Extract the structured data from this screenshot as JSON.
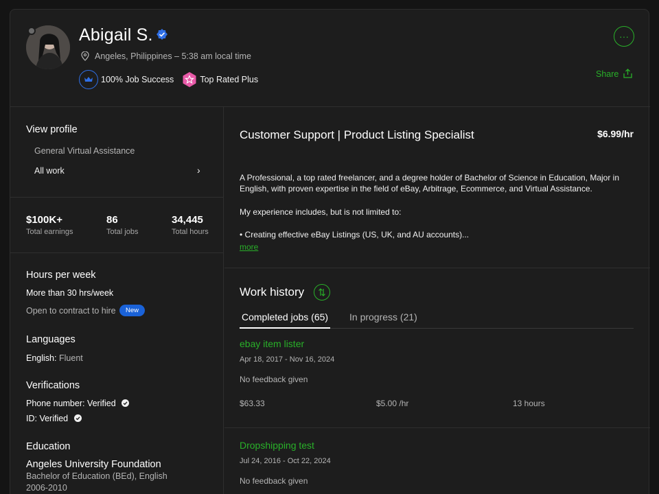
{
  "profile": {
    "name": "Abigail S.",
    "location": "Angeles, Philippines – 5:38 am local time",
    "badges": {
      "job_success": "100% Job Success",
      "top_rated": "Top Rated Plus"
    },
    "share_label": "Share",
    "more_label": "···"
  },
  "sidebar": {
    "view_profile_title": "View profile",
    "profile_items": [
      "General Virtual Assistance",
      "All work"
    ],
    "stats": [
      {
        "value": "$100K+",
        "label": "Total earnings"
      },
      {
        "value": "86",
        "label": "Total jobs"
      },
      {
        "value": "34,445",
        "label": "Total hours"
      }
    ],
    "hours_title": "Hours per week",
    "hours_value": "More than 30 hrs/week",
    "contract_to_hire": "Open to contract to hire",
    "new_badge": "New",
    "languages_title": "Languages",
    "language_name": "English:",
    "language_level": "Fluent",
    "verifications_title": "Verifications",
    "phone_verified": "Phone number: Verified",
    "id_verified": "ID: Verified",
    "education_title": "Education",
    "school": "Angeles University Foundation",
    "degree": "Bachelor of Education (BEd), English",
    "years": "2006-2010"
  },
  "main": {
    "title": "Customer Support | Product Listing Specialist",
    "rate": "$6.99/hr",
    "desc_p1_l1": "A Professional, a top rated freelancer, and a degree holder of Bachelor of Science in Education, Major in",
    "desc_p1_l2": "English, with proven expertise in the field of eBay, Arbitrage, Ecommerce, and Virtual Assistance.",
    "desc_p2": "My experience includes, but is not limited to:",
    "desc_p3": "• Creating effective eBay Listings (US, UK, and AU accounts)...",
    "more_link": "more",
    "work_history_title": "Work history",
    "tabs": [
      {
        "label": "Completed jobs (65)"
      },
      {
        "label": "In progress (21)"
      }
    ],
    "jobs": [
      {
        "title": "ebay item lister",
        "dates": "Apr 18, 2017 - Nov 16, 2024",
        "feedback": "No feedback given",
        "earned": "$63.33",
        "rate": "$5.00 /hr",
        "hours": "13 hours"
      },
      {
        "title": "Dropshipping test",
        "dates": "Jul 24, 2016 - Oct 22, 2024",
        "feedback": "No feedback given"
      }
    ]
  },
  "colors": {
    "accent_green": "#29b129",
    "verified_blue": "#2f6fe6",
    "badge_pink": "#e85aa8"
  }
}
